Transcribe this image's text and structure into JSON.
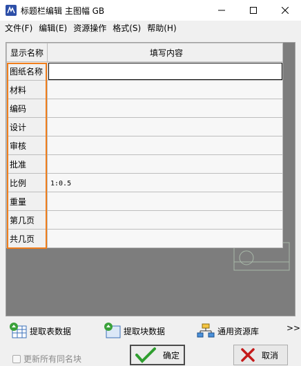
{
  "window": {
    "title": "标题栏编辑 主图幅 GB"
  },
  "menu": {
    "items": [
      "文件(F)",
      "编辑(E)",
      "资源操作",
      "格式(S)",
      "帮助(H)"
    ]
  },
  "table": {
    "headers": [
      "显示名称",
      "填写内容"
    ],
    "rows": [
      {
        "name": "图纸名称",
        "value": ""
      },
      {
        "name": "材料",
        "value": ""
      },
      {
        "name": "编码",
        "value": ""
      },
      {
        "name": "设计",
        "value": ""
      },
      {
        "name": "审核",
        "value": ""
      },
      {
        "name": "批准",
        "value": ""
      },
      {
        "name": "比例",
        "value": "1:0.5"
      },
      {
        "name": "重量",
        "value": ""
      },
      {
        "name": "第几页",
        "value": ""
      },
      {
        "name": "共几页",
        "value": ""
      }
    ]
  },
  "toolbar": {
    "extract_table": "提取表数据",
    "extract_block": "提取块数据",
    "resource_lib": "通用资源库",
    "more": ">>"
  },
  "footer": {
    "update_same_name": "更新所有同名块",
    "ok_label": "确定",
    "cancel_label": "取消"
  },
  "colors": {
    "highlight": "#f07d1a",
    "ok_check": "#2f9e2f",
    "cancel_x": "#c41a1a"
  }
}
